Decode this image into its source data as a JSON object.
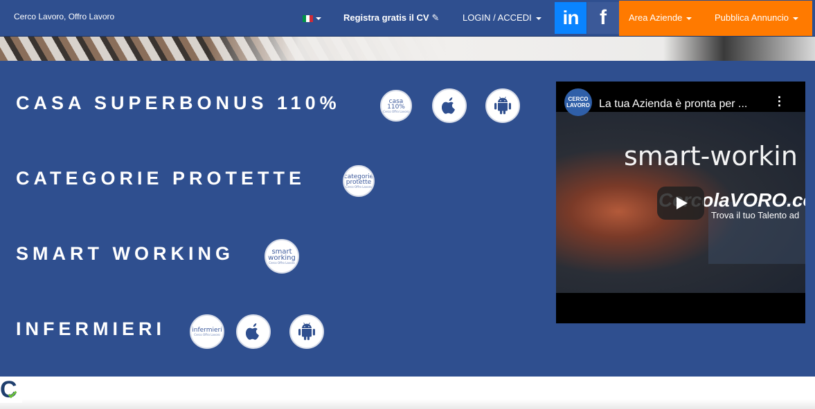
{
  "navbar": {
    "brand": "Cerco Lavoro, Offro Lavoro",
    "register_label": "Registra gratis il CV",
    "login_label": "LOGIN / ACCEDI",
    "linkedin_label": "in",
    "facebook_label": "f",
    "area_aziende_label": "Area Aziende",
    "pubblica_label": "Pubblica Annuncio",
    "flag_colors": [
      "#009246",
      "#ffffff",
      "#ce2b37"
    ],
    "accent_color": "#ff7a00"
  },
  "sections": [
    {
      "title": "CASA SUPERBONUS 110%",
      "logo_main": "casa 110%",
      "logo_sub": "Cerco Offro Lavoro"
    },
    {
      "title": "CATEGORIE PROTETTE",
      "logo_main": "categorie protette",
      "logo_sub": "Cerco Offro Lavoro"
    },
    {
      "title": "SMART WORKING",
      "logo_main": "smart working",
      "logo_sub": "Cerco Offro Lavoro"
    },
    {
      "title": "INFERMIERI",
      "logo_main": "infermieri",
      "logo_sub": "Cerco Offro Lavoro"
    }
  ],
  "icons": {
    "apple": "apple-icon",
    "android": "android-icon"
  },
  "video": {
    "title": "La tua Azienda è pronta per ...",
    "channel_label": "CERCO LAVORO",
    "overlay_text": "smart-workin",
    "brand_text": "CercolaVORO.co",
    "tagline": "Trova il tuo Talento ad"
  },
  "colors": {
    "primary_blue": "#2f4f8f",
    "orange": "#ff7a00",
    "linkedin": "#0a84ff",
    "facebook": "#3b5998"
  }
}
